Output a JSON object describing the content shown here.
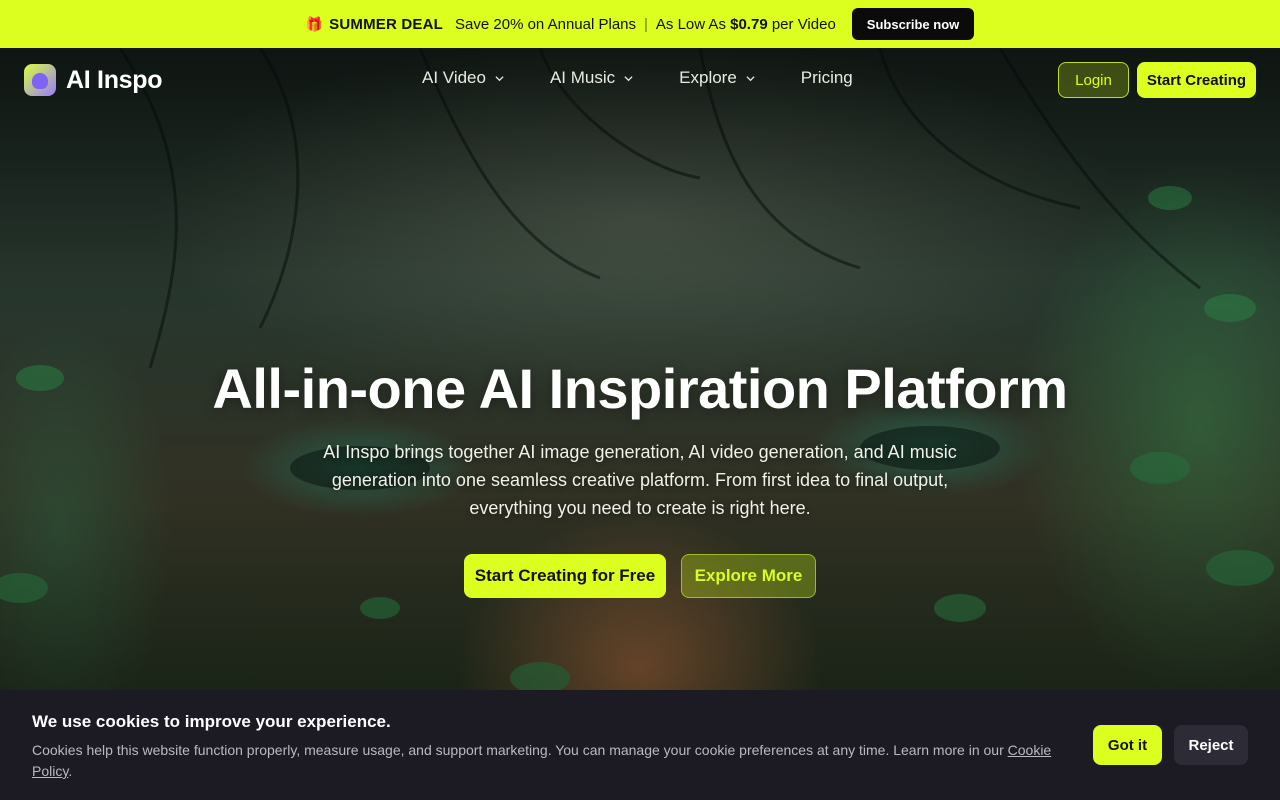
{
  "promo": {
    "gift_icon": "gift-icon",
    "deal_label": "SUMMER DEAL",
    "offer_text": "Save 20% on Annual Plans",
    "as_low_as": "As Low As",
    "price": "$0.79",
    "per_unit": "per Video",
    "subscribe_label": "Subscribe now",
    "background_color": "#dcff1f"
  },
  "header": {
    "logo_text": "AI Inspo",
    "nav": [
      {
        "label": "AI Video",
        "icon": "chevron-down-icon"
      },
      {
        "label": "AI Music",
        "icon": "chevron-down-icon"
      },
      {
        "label": "Explore",
        "icon": "chevron-down-icon"
      },
      {
        "label": "Pricing"
      }
    ],
    "login_label": "Login",
    "start_label": "Start Creating"
  },
  "hero": {
    "title": "All-in-one AI Inspiration Platform",
    "description": "AI Inspo brings together AI image generation, AI video generation, and AI music generation into one seamless creative platform. From first idea to final output, everything you need to create is right here.",
    "primary_cta": "Start Creating for Free",
    "secondary_cta": "Explore More",
    "accent_color": "#dcff1f"
  },
  "cookie": {
    "title": "We use cookies to improve your experience.",
    "body": "Cookies help this website function properly, measure usage, and support marketing. You can manage your cookie preferences at any time. Learn more in our",
    "link_label": "Cookie Policy",
    "accept_label": "Got it",
    "reject_label": "Reject",
    "background_color": "#1c1b24"
  }
}
